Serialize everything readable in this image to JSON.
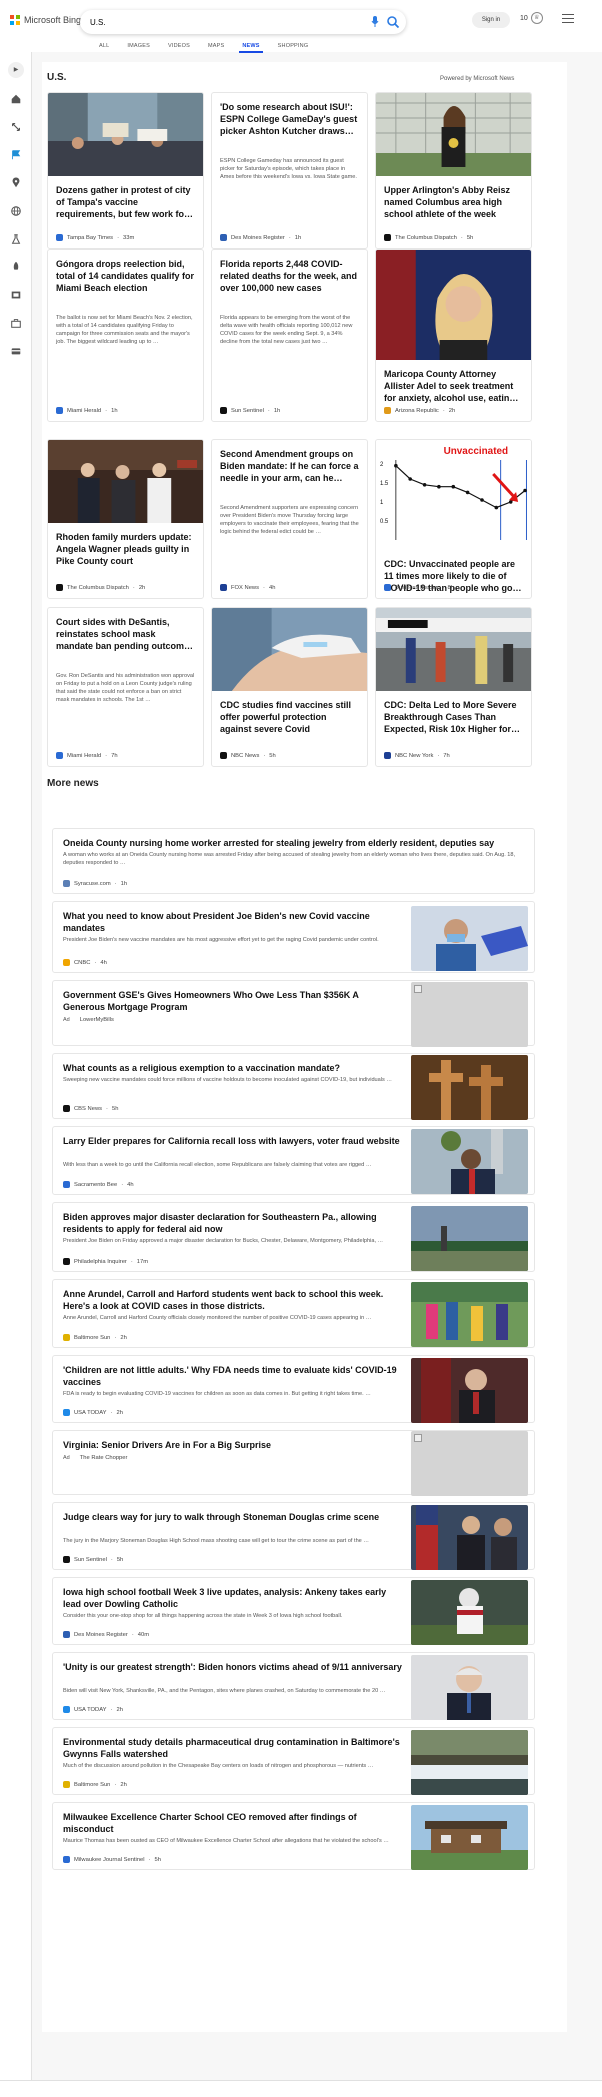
{
  "header": {
    "brand": "Microsoft Bing",
    "query": "U.S.",
    "signin": "Sign in",
    "reward_points": "10",
    "tabs": [
      "ALL",
      "IMAGES",
      "VIDEOS",
      "MAPS",
      "NEWS",
      "SHOPPING"
    ],
    "active_tab": "NEWS"
  },
  "section": {
    "title": "U.S.",
    "powered": "Powered by Microsoft News"
  },
  "cards": [
    {
      "title": "Dozens gather in protest of city of Tampa's vaccine requirements, but few work fo…",
      "snippet": "",
      "source": "Tampa Bay Times",
      "age": "33m",
      "fav": "#2a6ad3",
      "has_image": true
    },
    {
      "title": "'Do some research about ISU!': ESPN College GameDay's guest picker Ashton Kutcher draws…",
      "snippet": "ESPN College Gameday has announced its guest picker for Saturday's episode, which takes place in Ames before this weekend's Iowa vs. Iowa State game.",
      "source": "Des Moines Register",
      "age": "1h",
      "fav": "#2d5fb3",
      "has_image": false
    },
    {
      "title": "Upper Arlington's Abby Reisz named Columbus area high school athlete of the week",
      "snippet": "",
      "source": "The Columbus Dispatch",
      "age": "5h",
      "fav": "#111111",
      "has_image": true
    },
    {
      "title": "Góngora drops reelection bid, total of 14 candidates qualify for Miami Beach election",
      "snippet": "The ballot is now set for Miami Beach's Nov. 2 election, with a total of 14 candidates qualifying Friday to campaign for three commission seats and the mayor's job. The biggest wildcard leading up to …",
      "source": "Miami Herald",
      "age": "1h",
      "fav": "#2a6ad3",
      "has_image": false
    },
    {
      "title": "Florida reports 2,448 COVID-related deaths for the week, and over 100,000 new cases",
      "snippet": "Florida appears to be emerging from the worst of the delta wave with health officials reporting 100,012 new COVID cases for the week ending Sept. 9, a 34% decline from the total new cases just two …",
      "source": "Sun Sentinel",
      "age": "1h",
      "fav": "#111111",
      "has_image": false
    },
    {
      "title": "Maricopa County Attorney Allister Adel to seek treatment for anxiety, alcohol use, eatin…",
      "snippet": "",
      "source": "Arizona Republic",
      "age": "2h",
      "fav": "#e09a1a",
      "has_image": true
    },
    {
      "title": "Rhoden family murders update: Angela Wagner pleads guilty in Pike County court",
      "snippet": "",
      "source": "The Columbus Dispatch",
      "age": "2h",
      "fav": "#111111",
      "has_image": true
    },
    {
      "title": "Second Amendment groups on Biden mandate: If he can force a needle in your arm, can he…",
      "snippet": "Second Amendment supporters are expressing concern over President Biden's move Thursday forcing large employers to vaccinate their employees, fearing that the logic behind the federal edict could be …",
      "source": "FOX News",
      "age": "4h",
      "fav": "#1c3f94",
      "has_image": false
    },
    {
      "title": "CDC: Unvaccinated people are 11 times more likely to die of COVID-19 than people who go…",
      "snippet": "",
      "source": "Business Insider",
      "age": "8h",
      "fav": "#2a6ad3",
      "has_image": true
    },
    {
      "title": "Court sides with DeSantis, reinstates school mask mandate ban pending outcom…",
      "snippet": "Gov. Ron DeSantis and his administration won approval on Friday to put a hold on a Leon County judge's ruling that said the state could not enforce a ban on strict mask mandates in schools. The 1st …",
      "source": "Miami Herald",
      "age": "7h",
      "fav": "#2a6ad3",
      "has_image": false
    },
    {
      "title": "CDC studies find vaccines still offer powerful protection against severe Covid",
      "snippet": "",
      "source": "NBC News",
      "age": "5h",
      "fav": "#111111",
      "has_image": true
    },
    {
      "title": "CDC: Delta Led to More Severe Breakthrough Cases Than Expected, Risk 10x Higher for…",
      "snippet": "",
      "source": "NBC New York",
      "age": "7h",
      "fav": "#1c3f94",
      "has_image": true
    }
  ],
  "chart_thumb": {
    "label": "Unvaccinated",
    "ticks": [
      "2",
      "1.5",
      "1",
      "0.5"
    ]
  },
  "more_news": {
    "title": "More news",
    "items": [
      {
        "title": "Oneida County nursing home worker arrested for stealing jewelry from elderly resident, deputies say",
        "snippet": "A woman who works at an Oneida County nursing home was arrested Friday after being accused of stealing jewelry from an elderly woman who lives there, deputies said. On Aug. 18, deputies responded to …",
        "source": "Syracuse.com",
        "age": "1h",
        "fav": "#5b7fb5",
        "image": "none",
        "ad": ""
      },
      {
        "title": "What you need to know about President Joe Biden's new Covid vaccine mandates",
        "snippet": "President Joe Biden's new vaccine mandates are his most aggressive effort yet to get the raging Covid pandemic under control.",
        "source": "CNBC",
        "age": "4h",
        "fav": "#f0a500",
        "image": "photo",
        "ad": ""
      },
      {
        "title": "Government GSE's Gives Homeowners Who Owe Less Than $356K A Generous Mortgage Program",
        "snippet": "",
        "source": "LowerMyBills",
        "age": "",
        "fav": "",
        "image": "broken",
        "ad": "Ad"
      },
      {
        "title": "What counts as a religious exemption to a vaccination mandate?",
        "snippet": "Sweeping new vaccine mandates could force millions of vaccine holdouts to become inoculated against COVID-19, but individuals …",
        "source": "CBS News",
        "age": "5h",
        "fav": "#111111",
        "image": "photo",
        "ad": ""
      },
      {
        "title": "Larry Elder prepares for California recall loss with lawyers, voter fraud website",
        "snippet": "With less than a week to go until the California recall election, some Republicans are falsely claiming that votes are rigged …",
        "source": "Sacramento Bee",
        "age": "4h",
        "fav": "#2a6ad3",
        "image": "photo",
        "ad": ""
      },
      {
        "title": "Biden approves major disaster declaration for Southeastern Pa., allowing residents to apply for federal aid now",
        "snippet": "President Joe Biden on Friday approved a major disaster declaration for Bucks, Chester, Delaware, Montgomery, Philadelphia, …",
        "source": "Philadelphia Inquirer",
        "age": "17m",
        "fav": "#111111",
        "image": "photo",
        "ad": ""
      },
      {
        "title": "Anne Arundel, Carroll and Harford students went back to school this week. Here's a look at COVID cases in those districts.",
        "snippet": "Anne Arundel, Carroll and Harford County officials closely monitored the number of positive COVID-19 cases appearing in …",
        "source": "Baltimore Sun",
        "age": "2h",
        "fav": "#e0b100",
        "image": "photo",
        "ad": ""
      },
      {
        "title": "'Children are not little adults.' Why FDA needs time to evaluate kids' COVID-19 vaccines",
        "snippet": "FDA is ready to begin evaluating COVID-19 vaccines for children as soon as data comes in. But getting it right takes time. …",
        "source": "USA TODAY",
        "age": "2h",
        "fav": "#1f8ae8",
        "image": "photo",
        "ad": ""
      },
      {
        "title": "Virginia: Senior Drivers Are in For a Big Surprise",
        "snippet": "",
        "source": "The Rate Chopper",
        "age": "",
        "fav": "",
        "image": "broken",
        "ad": "Ad"
      },
      {
        "title": "Judge clears way for jury to walk through Stoneman Douglas crime scene",
        "snippet": "The jury in the Marjory Stoneman Douglas High School mass shooting case will get to tour the crime scene as part of the …",
        "source": "Sun Sentinel",
        "age": "5h",
        "fav": "#111111",
        "image": "photo",
        "ad": ""
      },
      {
        "title": "Iowa high school football Week 3 live updates, analysis: Ankeny takes early lead over Dowling Catholic",
        "snippet": "Consider this your one-stop shop for all things happening across the state in Week 3 of Iowa high school football.",
        "source": "Des Moines Register",
        "age": "40m",
        "fav": "#2d5fb3",
        "image": "photo",
        "ad": ""
      },
      {
        "title": "'Unity is our greatest strength': Biden honors victims ahead of 9/11 anniversary",
        "snippet": "Biden will visit New York, Shanksville, PA., and the Pentagon, sites where planes crashed, on Saturday to commemorate the 20 …",
        "source": "USA TODAY",
        "age": "2h",
        "fav": "#1f8ae8",
        "image": "photo",
        "ad": ""
      },
      {
        "title": "Environmental study details pharmaceutical drug contamination in Baltimore's Gwynns Falls watershed",
        "snippet": "Much of the discussion around pollution in the Chesapeake Bay centers on loads of nitrogen and phosphorous — nutrients …",
        "source": "Baltimore Sun",
        "age": "2h",
        "fav": "#e0b100",
        "image": "photo",
        "ad": ""
      },
      {
        "title": "Milwaukee Excellence Charter School CEO removed after findings of misconduct",
        "snippet": "Maurice Thomas has been ousted as CEO of Milwaukee Excellence Charter School after allegations that he violated the school's …",
        "source": "Milwaukee Journal Sentinel",
        "age": "5h",
        "fav": "#2a6ad3",
        "image": "photo",
        "ad": ""
      }
    ]
  },
  "sidebar_icons": [
    "home-icon",
    "expand-icon",
    "flag-icon",
    "map-pin-icon",
    "globe-icon",
    "science-icon",
    "rocket-icon",
    "film-icon",
    "briefcase-icon",
    "card-icon"
  ]
}
